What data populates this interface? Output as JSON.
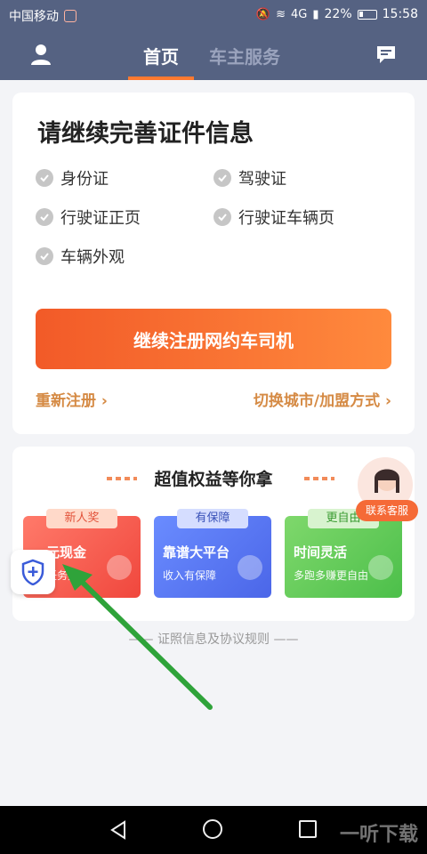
{
  "status_bar": {
    "carrier": "中国移动",
    "network": "4G",
    "battery": "22%",
    "time": "15:58"
  },
  "nav": {
    "tabs": [
      {
        "label": "首页",
        "active": true
      },
      {
        "label": "车主服务",
        "active": false
      }
    ]
  },
  "documents_card": {
    "title": "请继续完善证件信息",
    "items": [
      "身份证",
      "驾驶证",
      "行驶证正页",
      "行驶证车辆页",
      "车辆外观"
    ],
    "primary_button": "继续注册网约车司机",
    "link_reregister": "重新注册 ›",
    "link_switch_city": "切换城市/加盟方式 ›"
  },
  "benefits_card": {
    "title": "超值权益等你拿",
    "cards": [
      {
        "tag": "新人奖",
        "title": "元现金",
        "subtitle": "任务奖"
      },
      {
        "tag": "有保障",
        "title": "靠谱大平台",
        "subtitle": "收入有保障"
      },
      {
        "tag": "更自由",
        "title": "时间灵活",
        "subtitle": "多跑多赚更自由"
      }
    ]
  },
  "customer_service": {
    "label": "联系客服"
  },
  "footer": {
    "rules_text": "—— 证照信息及协议规则 ——"
  },
  "watermark": {
    "text": "一听下载"
  },
  "colors": {
    "header_bg": "#556282",
    "accent_orange": "#f56a37",
    "link": "#d58a44",
    "arrow": "#2fa33a"
  }
}
